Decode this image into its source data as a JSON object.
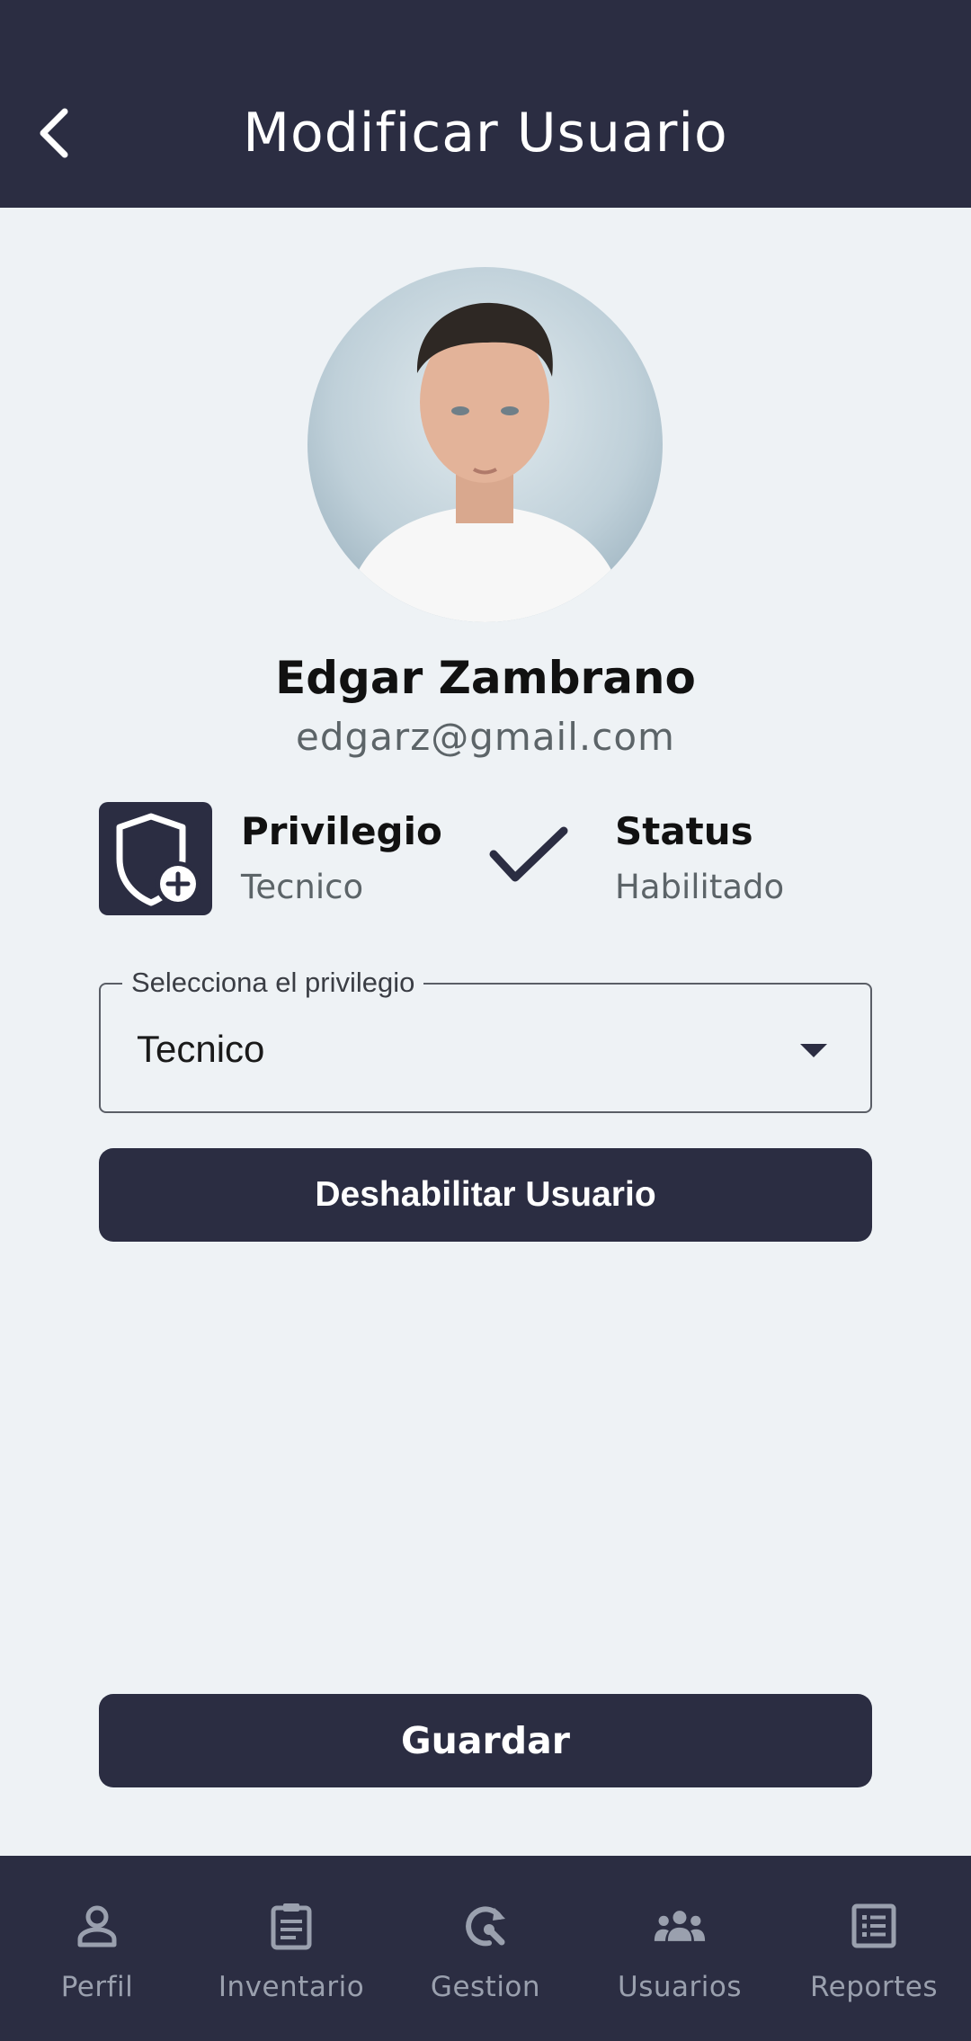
{
  "header": {
    "title": "Modificar Usuario"
  },
  "user": {
    "name": "Edgar Zambrano",
    "email": "edgarz@gmail.com"
  },
  "privilege": {
    "title": "Privilegio",
    "value": "Tecnico"
  },
  "status": {
    "title": "Status",
    "value": "Habilitado"
  },
  "select": {
    "label": "Selecciona el privilegio",
    "value": "Tecnico"
  },
  "buttons": {
    "disable_label": "Deshabilitar Usuario",
    "save_label": "Guardar"
  },
  "nav": {
    "items": [
      {
        "label": "Perfil",
        "icon": "person-icon"
      },
      {
        "label": "Inventario",
        "icon": "clipboard-icon"
      },
      {
        "label": "Gestion",
        "icon": "refresh-wrench-icon"
      },
      {
        "label": "Usuarios",
        "icon": "group-icon"
      },
      {
        "label": "Reportes",
        "icon": "list-icon"
      }
    ]
  },
  "colors": {
    "primary": "#2b2d42",
    "background": "#eef2f5",
    "nav_label": "#9aa0ae"
  }
}
